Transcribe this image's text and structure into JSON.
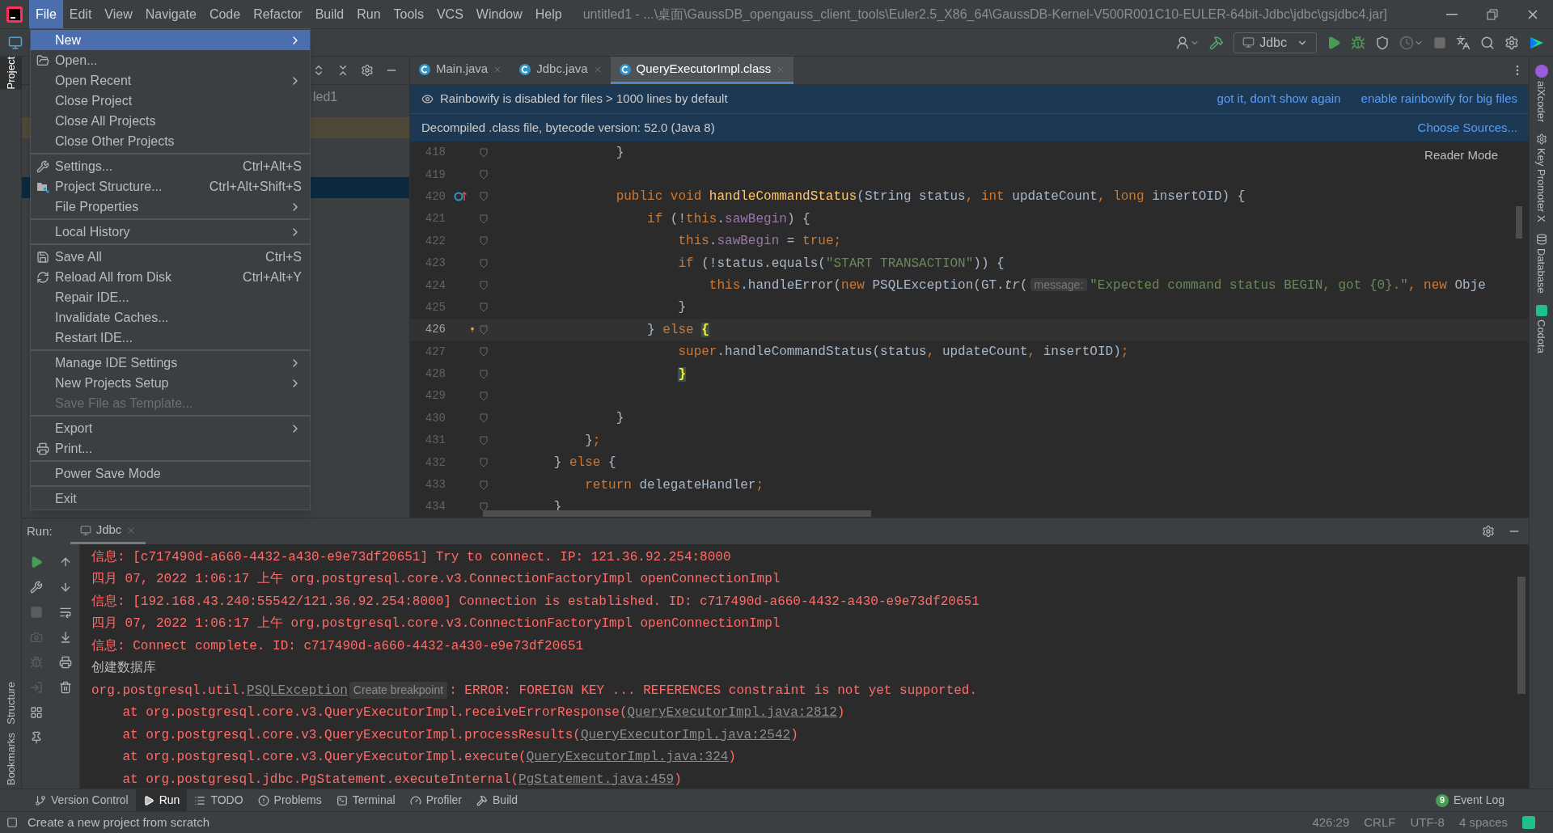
{
  "window": {
    "title": "untitled1 - ...\\桌面\\GaussDB_opengauss_client_tools\\Euler2.5_X86_64\\GaussDB-Kernel-V500R001C10-EULER-64bit-Jdbc\\jdbc\\gsjdbc4.jar]"
  },
  "menu_bar": [
    {
      "label": "File",
      "selected": true
    },
    {
      "label": "Edit",
      "selected": false
    },
    {
      "label": "View",
      "selected": false
    },
    {
      "label": "Navigate",
      "selected": false
    },
    {
      "label": "Code",
      "selected": false
    },
    {
      "label": "Refactor",
      "selected": false
    },
    {
      "label": "Build",
      "selected": false
    },
    {
      "label": "Run",
      "selected": false
    },
    {
      "label": "Tools",
      "selected": false
    },
    {
      "label": "VCS",
      "selected": false
    },
    {
      "label": "Window",
      "selected": false
    },
    {
      "label": "Help",
      "selected": false
    }
  ],
  "file_menu": [
    [
      {
        "label": "New",
        "kind": "plain",
        "submenu": true,
        "selected": true,
        "disabled": false
      },
      {
        "label": "Open...",
        "kind": "folder",
        "submenu": false,
        "selected": false,
        "disabled": false
      },
      {
        "label": "Open Recent",
        "kind": "plain",
        "submenu": true,
        "selected": false,
        "disabled": false
      },
      {
        "label": "Close Project",
        "kind": "plain",
        "submenu": false,
        "selected": false,
        "disabled": false
      },
      {
        "label": "Close All Projects",
        "kind": "plain",
        "submenu": false,
        "selected": false,
        "disabled": false
      },
      {
        "label": "Close Other Projects",
        "kind": "plain",
        "submenu": false,
        "selected": false,
        "disabled": false
      }
    ],
    [
      {
        "label": "Settings...",
        "shortcut": "Ctrl+Alt+S",
        "kind": "wrench",
        "submenu": false,
        "selected": false,
        "disabled": false
      },
      {
        "label": "Project Structure...",
        "shortcut": "Ctrl+Alt+Shift+S",
        "kind": "structure",
        "submenu": false,
        "selected": false,
        "disabled": false
      },
      {
        "label": "File Properties",
        "kind": "plain",
        "submenu": true,
        "selected": false,
        "disabled": false
      }
    ],
    [
      {
        "label": "Local History",
        "kind": "plain",
        "submenu": true,
        "selected": false,
        "disabled": false
      }
    ],
    [
      {
        "label": "Save All",
        "shortcut": "Ctrl+S",
        "kind": "save",
        "submenu": false,
        "selected": false,
        "disabled": false
      },
      {
        "label": "Reload All from Disk",
        "shortcut": "Ctrl+Alt+Y",
        "kind": "reload",
        "submenu": false,
        "selected": false,
        "disabled": false
      },
      {
        "label": "Repair IDE...",
        "kind": "plain",
        "submenu": false,
        "selected": false,
        "disabled": false
      },
      {
        "label": "Invalidate Caches...",
        "kind": "plain",
        "submenu": false,
        "selected": false,
        "disabled": false
      },
      {
        "label": "Restart IDE...",
        "kind": "plain",
        "submenu": false,
        "selected": false,
        "disabled": false
      }
    ],
    [
      {
        "label": "Manage IDE Settings",
        "kind": "plain",
        "submenu": true,
        "selected": false,
        "disabled": false
      },
      {
        "label": "New Projects Setup",
        "kind": "plain",
        "submenu": true,
        "selected": false,
        "disabled": false
      },
      {
        "label": "Save File as Template...",
        "kind": "plain",
        "submenu": false,
        "selected": false,
        "disabled": true
      }
    ],
    [
      {
        "label": "Export",
        "kind": "plain",
        "submenu": true,
        "selected": false,
        "disabled": false
      },
      {
        "label": "Print...",
        "kind": "print",
        "submenu": false,
        "selected": false,
        "disabled": false
      }
    ],
    [
      {
        "label": "Power Save Mode",
        "kind": "plain",
        "submenu": false,
        "selected": false,
        "disabled": false
      }
    ],
    [
      {
        "label": "Exit",
        "kind": "plain",
        "submenu": false,
        "selected": false,
        "disabled": false
      }
    ]
  ],
  "toolbar": {
    "run_config": "Jdbc"
  },
  "left_strip": [
    {
      "label": "Project",
      "selected": true
    },
    {
      "label": "Structure",
      "selected": false
    },
    {
      "label": "Bookmarks",
      "selected": false
    }
  ],
  "right_strip": [
    {
      "label": "aiXcoder"
    },
    {
      "label": "Key Promoter X"
    },
    {
      "label": "Database"
    },
    {
      "label": "Codota"
    }
  ],
  "project_panel": {
    "visible_text": "led1"
  },
  "editor": {
    "tabs": [
      {
        "label": "Main.java",
        "selected": false
      },
      {
        "label": "Jdbc.java",
        "selected": false
      },
      {
        "label": "QueryExecutorImpl.class",
        "selected": true
      }
    ],
    "notice": {
      "text": "Rainbowify is disabled for files > 1000 lines by default",
      "actions": [
        "got it, don't show again",
        "enable rainbowify for big files"
      ]
    },
    "decompiled": {
      "text": "Decompiled .class file, bytecode version: 52.0 (Java 8)",
      "action": "Choose Sources..."
    },
    "reader_mode": "Reader Mode",
    "lines": [
      {
        "number": "418",
        "current": false,
        "tokens": [
          {
            "text": "                }",
            "kind": "plain"
          }
        ]
      },
      {
        "number": "419",
        "current": false
      },
      {
        "number": "420",
        "current": false,
        "kind": "override",
        "tokens": [
          {
            "text": "                public void ",
            "kind": "keyword"
          },
          {
            "text": "handleCommandStatus",
            "kind": "method"
          },
          {
            "text": "(String status",
            "kind": "plain"
          },
          {
            "text": ", ",
            "kind": "keyword"
          },
          {
            "text": "int ",
            "kind": "keyword"
          },
          {
            "text": "updateCount",
            "kind": "plain"
          },
          {
            "text": ", ",
            "kind": "keyword"
          },
          {
            "text": "long ",
            "kind": "keyword"
          },
          {
            "text": "insertOID) {",
            "kind": "plain"
          }
        ]
      },
      {
        "number": "421",
        "current": false,
        "tokens": [
          {
            "text": "                    if ",
            "kind": "keyword"
          },
          {
            "text": "(!",
            "kind": "plain"
          },
          {
            "text": "this",
            "kind": "keyword"
          },
          {
            "text": ".",
            "kind": "plain"
          },
          {
            "text": "sawBegin",
            "kind": "field"
          },
          {
            "text": ") {",
            "kind": "plain"
          }
        ]
      },
      {
        "number": "422",
        "current": false,
        "tokens": [
          {
            "text": "                        this",
            "kind": "keyword"
          },
          {
            "text": ".",
            "kind": "plain"
          },
          {
            "text": "sawBegin",
            "kind": "field"
          },
          {
            "text": " = ",
            "kind": "plain"
          },
          {
            "text": "true",
            "kind": "keyword"
          },
          {
            "text": ";",
            "kind": "keyword"
          }
        ]
      },
      {
        "number": "423",
        "current": false,
        "tokens": [
          {
            "text": "                        if ",
            "kind": "keyword"
          },
          {
            "text": "(!status.equals(",
            "kind": "plain"
          },
          {
            "text": "\"START TRANSACTION\"",
            "kind": "string"
          },
          {
            "text": ")) {",
            "kind": "plain"
          }
        ]
      },
      {
        "number": "424",
        "current": false,
        "tokens": [
          {
            "text": "                            this",
            "kind": "keyword"
          },
          {
            "text": ".handleError(",
            "kind": "plain"
          },
          {
            "text": "new ",
            "kind": "keyword"
          },
          {
            "text": "PSQLException(GT.",
            "kind": "plain"
          },
          {
            "text": "tr",
            "kind": "italic"
          },
          {
            "text": "(",
            "kind": "plain"
          },
          {
            "text": "message:",
            "kind": "hint"
          },
          {
            "text": "\"Expected command status BEGIN, got {0}.\"",
            "kind": "string"
          },
          {
            "text": ", ",
            "kind": "keyword"
          },
          {
            "text": "new ",
            "kind": "keyword"
          },
          {
            "text": "Obje",
            "kind": "plain"
          }
        ]
      },
      {
        "number": "425",
        "current": false,
        "tokens": [
          {
            "text": "                        }",
            "kind": "plain"
          }
        ]
      },
      {
        "number": "426",
        "current": true,
        "kind": "bulb",
        "tokens": [
          {
            "text": "                    } ",
            "kind": "plain"
          },
          {
            "text": "else ",
            "kind": "keyword"
          },
          {
            "text": "{",
            "kind": "brace"
          }
        ]
      },
      {
        "number": "427",
        "current": false,
        "tokens": [
          {
            "text": "                        super",
            "kind": "keyword"
          },
          {
            "text": ".handleCommandStatus(status",
            "kind": "plain"
          },
          {
            "text": ", ",
            "kind": "keyword"
          },
          {
            "text": "updateCount",
            "kind": "plain"
          },
          {
            "text": ", ",
            "kind": "keyword"
          },
          {
            "text": "insertOID)",
            "kind": "plain"
          },
          {
            "text": ";",
            "kind": "keyword"
          }
        ]
      },
      {
        "number": "428",
        "current": false,
        "tokens": [
          {
            "text": "                        }",
            "kind": "brace"
          }
        ]
      },
      {
        "number": "429",
        "current": false
      },
      {
        "number": "430",
        "current": false,
        "tokens": [
          {
            "text": "                }",
            "kind": "plain"
          }
        ]
      },
      {
        "number": "431",
        "current": false,
        "tokens": [
          {
            "text": "            }",
            "kind": "plain"
          },
          {
            "text": ";",
            "kind": "keyword"
          }
        ]
      },
      {
        "number": "432",
        "current": false,
        "tokens": [
          {
            "text": "        } ",
            "kind": "plain"
          },
          {
            "text": "else ",
            "kind": "keyword"
          },
          {
            "text": "{",
            "kind": "plain"
          }
        ]
      },
      {
        "number": "433",
        "current": false,
        "tokens": [
          {
            "text": "            return ",
            "kind": "keyword"
          },
          {
            "text": "delegateHandler",
            "kind": "plain"
          },
          {
            "text": ";",
            "kind": "keyword"
          }
        ]
      },
      {
        "number": "434",
        "current": false,
        "tokens": [
          {
            "text": "        }",
            "kind": "plain"
          }
        ]
      }
    ]
  },
  "run_panel": {
    "label": "Run:",
    "tab": "Jdbc",
    "console": [
      [
        {
          "text": "信息: [c717490d-a660-4432-a430-e9e73df20651] Try to connect. IP: 121.36.92.254:8000",
          "kind": "error"
        }
      ],
      [
        {
          "text": "四月 07, 2022 1:06:17 上午 org.postgresql.core.v3.ConnectionFactoryImpl openConnectionImpl",
          "kind": "error"
        }
      ],
      [
        {
          "text": "信息: [192.168.43.240:55542/121.36.92.254:8000] Connection is established. ID: c717490d-a660-4432-a430-e9e73df20651",
          "kind": "error"
        }
      ],
      [
        {
          "text": "四月 07, 2022 1:06:17 上午 org.postgresql.core.v3.ConnectionFactoryImpl openConnectionImpl",
          "kind": "error"
        }
      ],
      [
        {
          "text": "信息: Connect complete. ID: c717490d-a660-4432-a430-e9e73df20651",
          "kind": "error"
        }
      ],
      [
        {
          "text": "创建数据库",
          "kind": "plain"
        }
      ],
      [
        {
          "text": "org.postgresql.util.",
          "kind": "error"
        },
        {
          "text": "PSQLException",
          "kind": "link"
        },
        {
          "text": "Create breakpoint",
          "kind": "hint"
        },
        {
          "text": ": ERROR: FOREIGN KEY ... REFERENCES constraint is not yet supported.",
          "kind": "error"
        }
      ],
      [
        {
          "text": "    at org.postgresql.core.v3.QueryExecutorImpl.receiveErrorResponse(",
          "kind": "error"
        },
        {
          "text": "QueryExecutorImpl.java:2812",
          "kind": "link"
        },
        {
          "text": ")",
          "kind": "error"
        }
      ],
      [
        {
          "text": "    at org.postgresql.core.v3.QueryExecutorImpl.processResults(",
          "kind": "error"
        },
        {
          "text": "QueryExecutorImpl.java:2542",
          "kind": "link"
        },
        {
          "text": ")",
          "kind": "error"
        }
      ],
      [
        {
          "text": "    at org.postgresql.core.v3.QueryExecutorImpl.execute(",
          "kind": "error"
        },
        {
          "text": "QueryExecutorImpl.java:324",
          "kind": "link"
        },
        {
          "text": ")",
          "kind": "error"
        }
      ],
      [
        {
          "text": "    at org.postgresql.jdbc.PgStatement.executeInternal(",
          "kind": "error"
        },
        {
          "text": "PgStatement.java:459",
          "kind": "link"
        },
        {
          "text": ")",
          "kind": "error"
        }
      ]
    ]
  },
  "tool_tabs": [
    {
      "label": "Version Control",
      "kind": "vcs",
      "selected": false
    },
    {
      "label": "Run",
      "kind": "run",
      "selected": true
    },
    {
      "label": "TODO",
      "kind": "todo",
      "selected": false
    },
    {
      "label": "Problems",
      "kind": "problems",
      "selected": false
    },
    {
      "label": "Terminal",
      "kind": "terminal",
      "selected": false
    },
    {
      "label": "Profiler",
      "kind": "profiler",
      "selected": false
    },
    {
      "label": "Build",
      "kind": "build",
      "selected": false
    }
  ],
  "event_log": {
    "label": "Event Log",
    "count": "9"
  },
  "status_bar": {
    "message": "Create a new project from scratch",
    "items": [
      "426:29",
      "CRLF",
      "UTF-8",
      "4 spaces"
    ]
  }
}
